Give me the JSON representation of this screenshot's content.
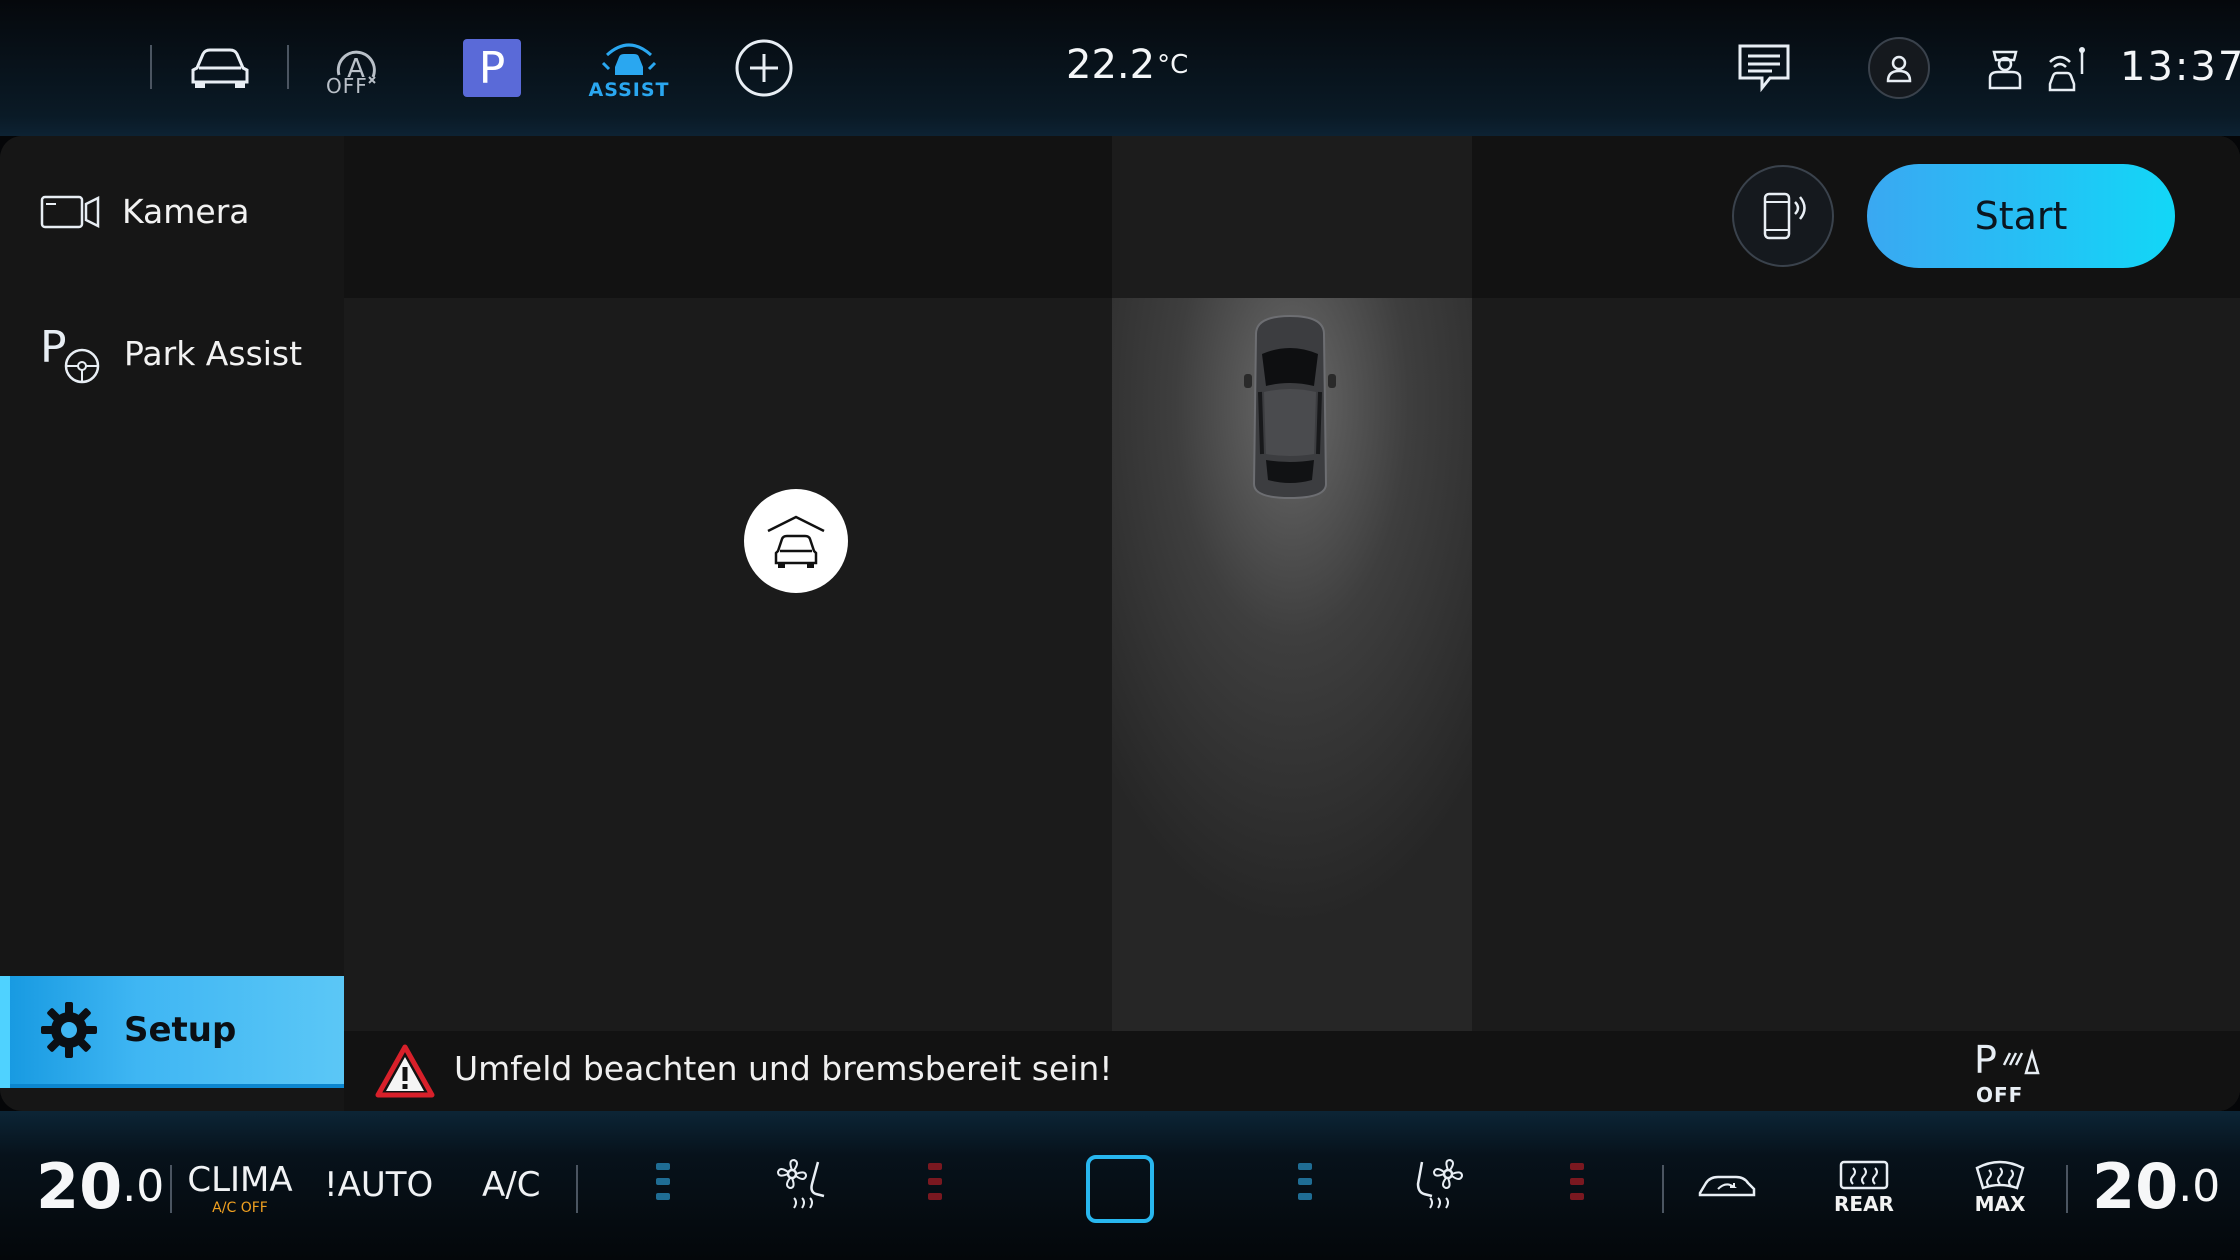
{
  "topbar": {
    "auto_hold_label": "OFF",
    "park_label": "P",
    "assist_label": "ASSIST",
    "outside_temp": "22.2",
    "outside_temp_unit": "°C",
    "clock": "13:37",
    "icons": [
      "apps-grid-icon",
      "vehicle-icon",
      "auto-hold-off-icon",
      "park-button-icon",
      "assist-icon",
      "add-icon",
      "message-icon",
      "profile-icon",
      "driver-icon",
      "car-connect-icon"
    ]
  },
  "sidebar": {
    "items": [
      {
        "label": "Kamera",
        "icon": "camera-icon"
      },
      {
        "label": "Park Assist",
        "icon": "park-assist-icon"
      }
    ],
    "setup_label": "Setup"
  },
  "view": {
    "start_label": "Start",
    "warning_text": "Umfeld beachten und bremsbereit sein!",
    "park_sensor_label": "OFF"
  },
  "climate": {
    "left_temp_int": "20",
    "left_temp_dec": ".0",
    "clima_label": "CLIMA",
    "clima_sub": "A/C OFF",
    "auto_label": "!AUTO",
    "ac_label": "A/C",
    "rear_label": "REAR",
    "max_label": "MAX",
    "right_temp_int": "20",
    "right_temp_dec": ".0",
    "colors": {
      "accent": "#28b7ef",
      "seat_cool": "#1f6d94",
      "seat_heat": "#7a1820"
    }
  }
}
